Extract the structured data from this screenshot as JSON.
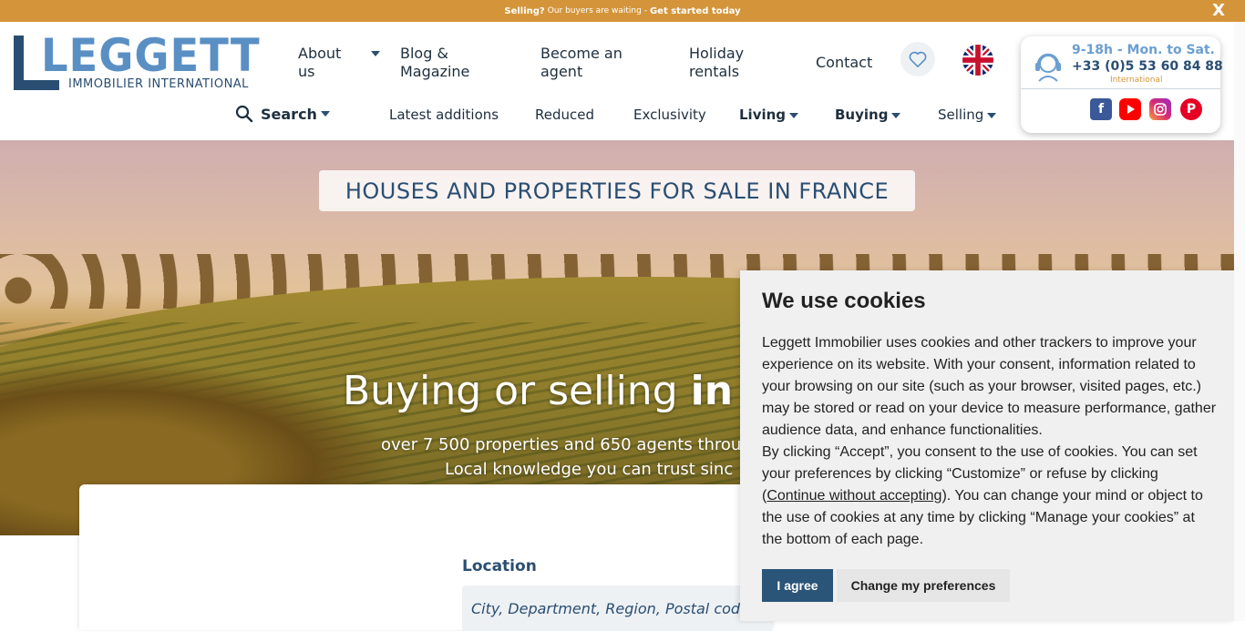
{
  "topbar": {
    "selling": "Selling?",
    "message": "Our buyers are waiting -",
    "cta": "Get started today",
    "close": "X"
  },
  "logo": {
    "name": "LEGGETT",
    "subtitle": "IMMOBILIER INTERNATIONAL"
  },
  "nav_primary": [
    {
      "label": "About us",
      "has_dropdown": true
    },
    {
      "label": "Blog & Magazine"
    },
    {
      "label": "Become an agent"
    },
    {
      "label": "Holiday rentals"
    },
    {
      "label": "Contact"
    }
  ],
  "nav_secondary": {
    "search": "Search",
    "items": [
      {
        "label": "Latest additions"
      },
      {
        "label": "Reduced"
      },
      {
        "label": "Exclusivity"
      },
      {
        "label": "Living",
        "bold": true
      },
      {
        "label": "Buying",
        "bold": true
      },
      {
        "label": "Selling"
      }
    ]
  },
  "contact": {
    "hours": "9-18h - Mon. to Sat.",
    "phone": "+33 (0)5 53 60 84 88",
    "region": "International",
    "social": [
      "facebook-icon",
      "youtube-icon",
      "instagram-icon",
      "pinterest-icon"
    ]
  },
  "hero": {
    "banner": "HOUSES AND PROPERTIES FOR SALE IN FRANCE",
    "headline_regular": "Buying or selling",
    "headline_bold": "in F",
    "sub1": "over 7 500 properties and 650 agents throu",
    "sub2": "Local knowledge you can trust sinc"
  },
  "search_panel": {
    "location_label": "Location",
    "location_placeholder": "City, Department, Region, Postal code"
  },
  "cookie": {
    "title": "We use cookies",
    "p1": "Leggett Immobilier uses cookies and other trackers to improve your experience on its website. With your consent, information related to your browsing on our site (such as your browser, visited pages, etc.) may be stored or read on your device to measure performance, gather audience data, and enhance functionalities.",
    "p2_before": "By clicking “Accept”, you consent to the use of cookies. You can set your preferences by clicking “Customize” or refuse by clicking (",
    "p2_link": "Continue without accepting",
    "p2_after": "). You can change your mind or object to the use of cookies at any time by clicking “Manage your cookies” at the bottom of each page.",
    "agree": "I agree",
    "preferences": "Change my preferences"
  },
  "colors": {
    "accent": "#d4953a",
    "brand": "#2a4e72",
    "brand_light": "#5a8fc4"
  }
}
